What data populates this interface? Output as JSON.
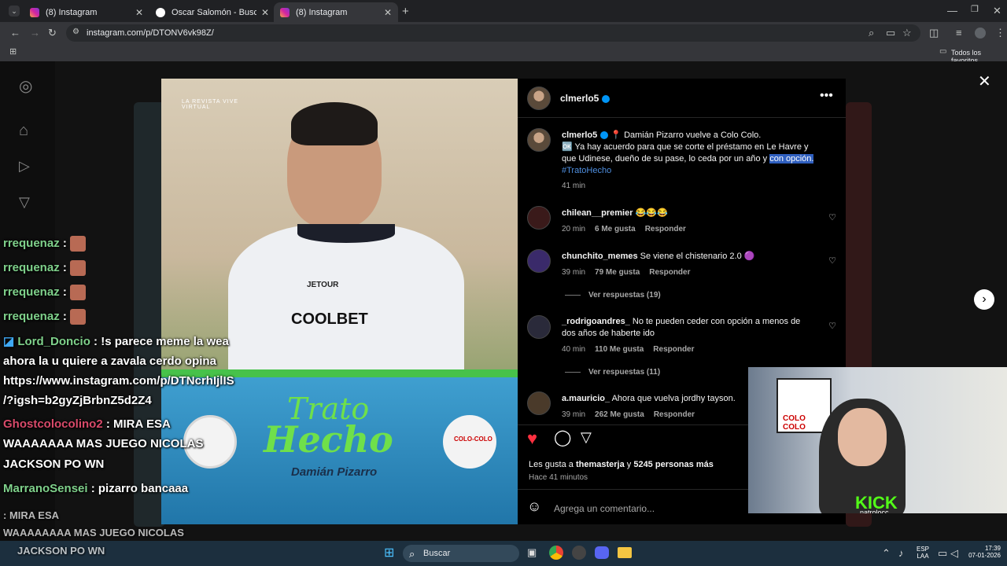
{
  "browser": {
    "tabs": [
      {
        "title": "(8) Instagram",
        "active": false
      },
      {
        "title": "Oscar Salomón - Buscar con Go",
        "active": false
      },
      {
        "title": "(8) Instagram",
        "active": true
      }
    ],
    "url": "instagram.com/p/DTONV6vk98Z/",
    "bookmarks_label": "Todos los favoritos"
  },
  "post": {
    "header_user": "clmerlo5",
    "caption_user": "clmerlo5",
    "caption_line1": "📍 Damián Pizarro vuelve a Colo Colo.",
    "caption_line2": "🆗 Ya hay acuerdo para que se corte el préstamo en Le Havre y",
    "caption_line3a": "que Udinese, dueño de su pase, lo ceda por un año y ",
    "caption_line3b": "con opción.",
    "caption_tag": "#TratoHecho",
    "caption_time": "41 min",
    "comments": [
      {
        "user": "chilean__premier",
        "text": "😂😂😂",
        "time": "20 min",
        "likes": "6 Me gusta",
        "reply": "Responder"
      },
      {
        "user": "chunchito_memes",
        "text": "Se viene el chistenario 2.0 🟣",
        "time": "39 min",
        "likes": "79 Me gusta",
        "reply": "Responder",
        "replies": "Ver respuestas (19)"
      },
      {
        "user": "_rodrigoandres_",
        "text": "No te pueden ceder con opción a menos de",
        "text2": "dos años de haberte ido",
        "time": "40 min",
        "likes": "110 Me gusta",
        "reply": "Responder",
        "replies": "Ver respuestas (11)"
      },
      {
        "user": "a.mauricio_",
        "text": "Ahora que vuelva jordhy tayson.",
        "time": "39 min",
        "likes": "262 Me gusta",
        "reply": "Responder"
      }
    ],
    "likes_text_a": "Les gusta a ",
    "likes_user": "themasterja",
    "likes_text_b": " y ",
    "likes_count": "5245 personas más",
    "posted_ago": "Hace 41 minutos",
    "comment_placeholder": "Agrega un comentario..."
  },
  "media": {
    "headline1": "Trato",
    "headline2": "Hecho",
    "player": "Damián Pizarro",
    "jersey_sponsor": "COOLBET",
    "jersey_brand": "JETOUR",
    "badge_right": "COLO-COLO",
    "corner_mark": "LA REVISTA VIVE VIRTUAL"
  },
  "chat": [
    {
      "user": "rrequenaz",
      "text": ":"
    },
    {
      "user": "rrequenaz",
      "text": ":"
    },
    {
      "user": "rrequenaz",
      "text": ":"
    },
    {
      "user": "rrequenaz",
      "text": ":"
    },
    {
      "user": "Lord_Doncio",
      "text": ": !s parece meme la wea"
    },
    {
      "user": "",
      "text": "ahora la u quiere a zavala cerdo opina"
    },
    {
      "user": "",
      "text": "https://www.instagram.com/p/DTNcrhIjlIS"
    },
    {
      "user": "",
      "text": "/?igsh=b2gyZjBrbnZ5d2Z4"
    },
    {
      "user": "Ghostcolocolino2",
      "text": ": MIRA ESA"
    },
    {
      "user": "",
      "text": "WAAAAAAA MAS JUEGO NICOLAS"
    },
    {
      "user": "",
      "text": "JACKSON PO WN"
    },
    {
      "user": "MarranoSensei",
      "text": ": pizarro bancaaa"
    },
    {
      "user": "",
      "text": ": MIRA ESA"
    },
    {
      "user": "",
      "text": "WAAAAAAAA MAS JUEGO NICOLAS"
    },
    {
      "user": "",
      "text": "JACKSON PO WN"
    }
  ],
  "webcam": {
    "logo": "KICK",
    "handle": "natrolocc",
    "flag_text": "COLO COLO"
  },
  "taskbar": {
    "search_label": "Buscar",
    "lang1": "ESP",
    "lang2": "LAA",
    "time": "17:39",
    "date": "07-01-2026"
  }
}
